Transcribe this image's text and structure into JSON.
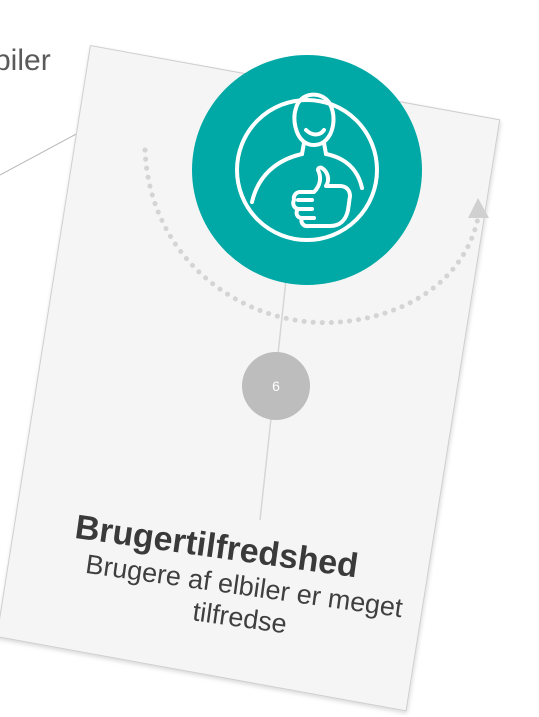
{
  "fragment_text": "biler",
  "step": {
    "number": "6"
  },
  "card": {
    "title": "Brugertilfredshed",
    "description": "Brugere af elbiler er meget tilfredse"
  },
  "colors": {
    "accent": "#00A9A5",
    "number_circle": "#BDBDBD",
    "arrow": "#D0D0D0",
    "card_background": "#F5F5F5"
  },
  "icons": {
    "main": "satisfied-user-thumbs-up-icon",
    "arrow": "dotted-arc-arrow-icon"
  }
}
